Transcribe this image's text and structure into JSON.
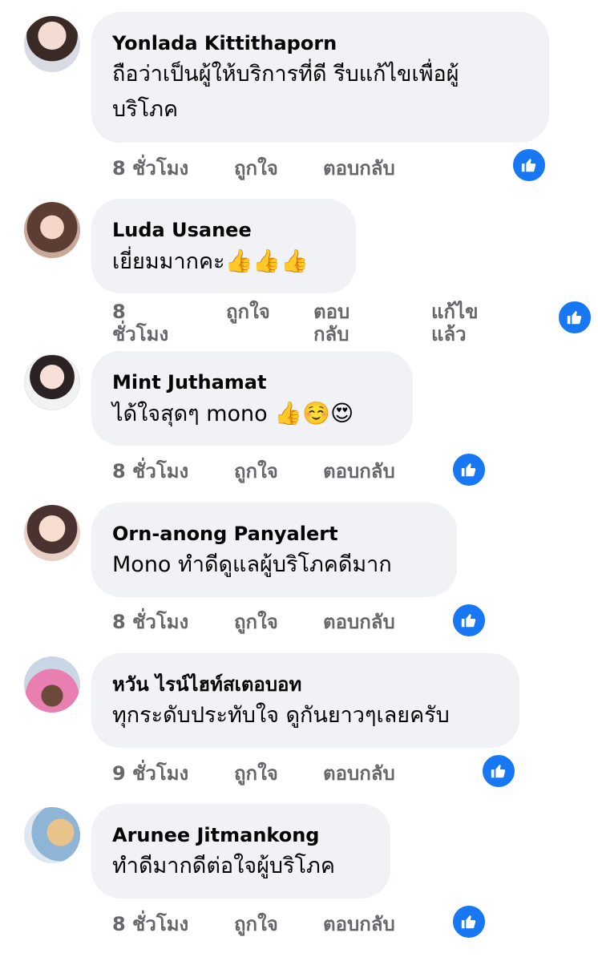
{
  "comments": [
    {
      "author": "Yonlada Kittithaporn",
      "text_line1": "ถือว่าเป็นผู้ให้บริการที่ดี รีบแก้ไขเพื่อผู้",
      "text_line2": "บริโภค",
      "time": "8 ชั่วโมง",
      "like": "ถูกใจ",
      "reply": "ตอบกลับ"
    },
    {
      "author": "Luda Usanee",
      "text": "เยี่ยมมากคะ",
      "emoji": "👍👍👍",
      "time_line1": "8",
      "time_line2": "ชั่วโมง",
      "like": "ถูกใจ",
      "reply_line1": "ตอบ",
      "reply_line2": "กลับ",
      "edited_line1": "แก้ไข",
      "edited_line2": "แล้ว"
    },
    {
      "author": "Mint Juthamat",
      "text": "ได้ใจสุดๆ mono",
      "emoji": "👍☺️😍",
      "time": "8 ชั่วโมง",
      "like": "ถูกใจ",
      "reply": "ตอบกลับ"
    },
    {
      "author": "Orn-anong Panyalert",
      "text": "Mono ทำดีดูแลผู้บริโภคดีมาก",
      "time": "8 ชั่วโมง",
      "like": "ถูกใจ",
      "reply": "ตอบกลับ"
    },
    {
      "author": "หวัน ไรน์ไฮท์สเตอบอท",
      "text": "ทุกระดับประทับใจ ดูกันยาวๆเลยครับ",
      "time": "9 ชั่วโมง",
      "like": "ถูกใจ",
      "reply": "ตอบกลับ"
    },
    {
      "author": "Arunee Jitmankong",
      "text": "ทำดีมากดีต่อใจผู้บริโภค",
      "time": "8 ชั่วโมง",
      "like": "ถูกใจ",
      "reply": "ตอบกลับ"
    }
  ],
  "icons": {
    "reaction": "thumbs-up-icon"
  },
  "colors": {
    "bubble": "#f0f2f5",
    "action_text": "#65676b",
    "like_badge": "#1877f2"
  }
}
